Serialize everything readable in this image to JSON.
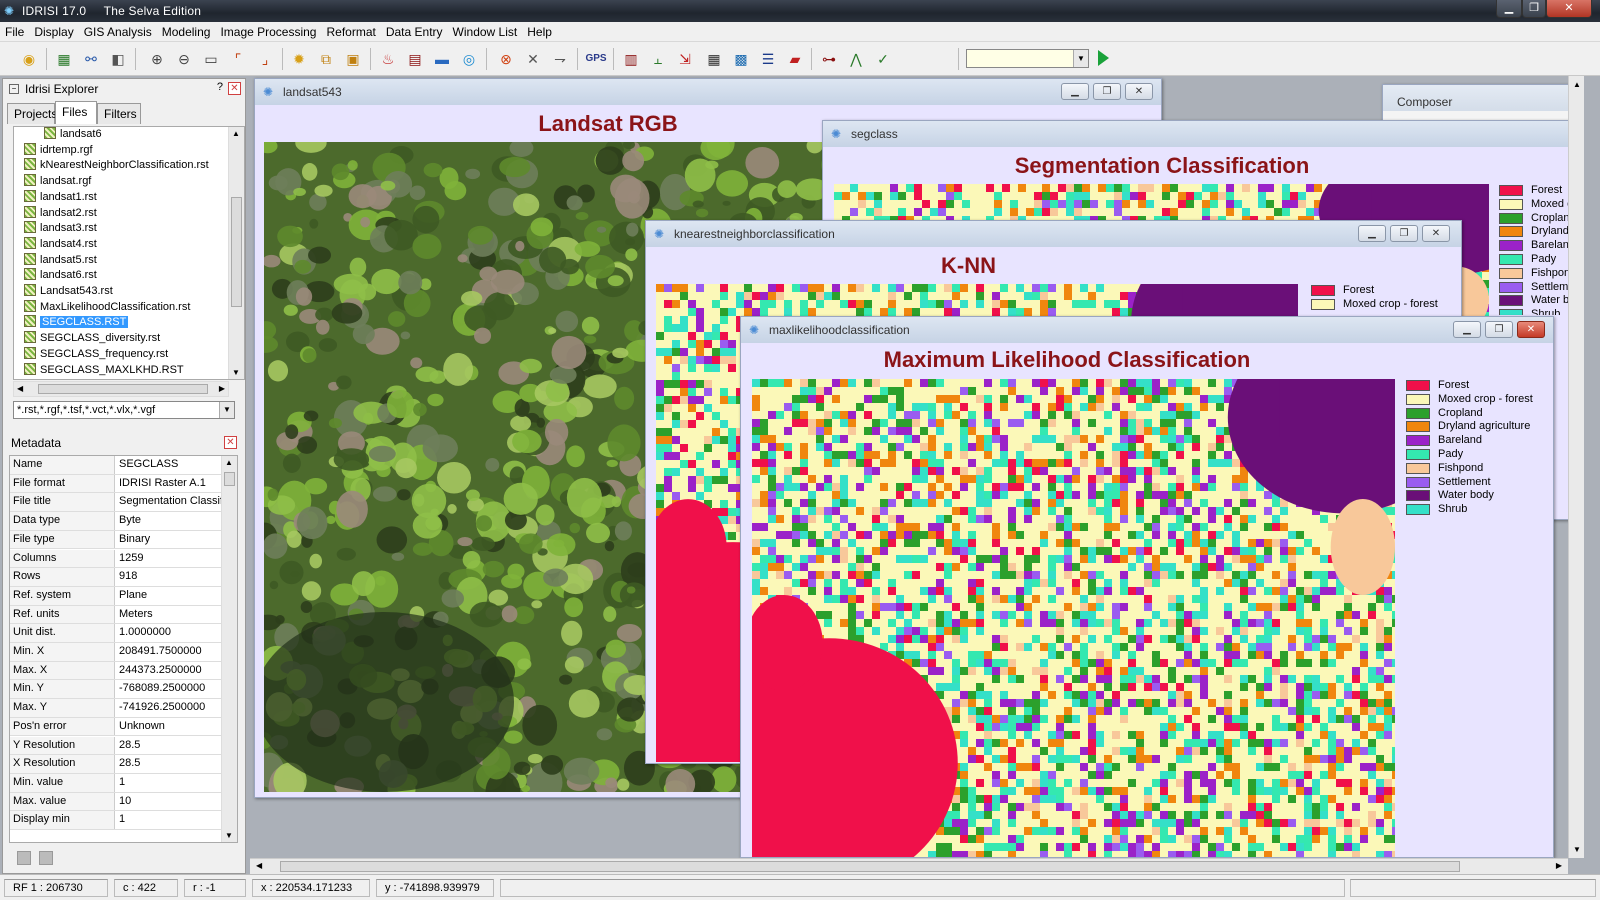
{
  "app": {
    "title": "IDRISI 17.0     The Selva Edition"
  },
  "menu": [
    "File",
    "Display",
    "GIS Analysis",
    "Modeling",
    "Image Processing",
    "Reformat",
    "Data Entry",
    "Window List",
    "Help"
  ],
  "toolbar": {
    "icons": [
      "open-icon",
      "display-icon",
      "composer-icon",
      "layer-icon",
      "zoom-in-icon",
      "zoom-out-icon",
      "zoom-window-icon",
      "pan-icon",
      "measure-icon",
      "query-icon",
      "digitize-icon",
      "palette-icon",
      "tool-icon",
      "database-icon",
      "scale-icon",
      "globe-icon",
      "target-icon",
      "tools-icon",
      "select-icon",
      "gps-icon",
      "histogram-icon",
      "profile-icon",
      "export-icon",
      "table-icon",
      "grid-icon",
      "list-icon",
      "eraser-icon",
      "macro-icon",
      "model-icon",
      "graph-icon"
    ],
    "combo_value": ""
  },
  "explorer": {
    "title": "Idrisi Explorer",
    "help": "?",
    "tabs": [
      "Projects",
      "Files",
      "Filters"
    ],
    "active_tab": 1,
    "files": [
      "landsat6",
      "idrtemp.rgf",
      "kNearestNeighborClassification.rst",
      "landsat.rgf",
      "landsat1.rst",
      "landsat2.rst",
      "landsat3.rst",
      "landsat4.rst",
      "landsat5.rst",
      "landsat6.rst",
      "Landsat543.rst",
      "MaxLikelihoodClassification.rst",
      "SEGCLASS.RST",
      "SEGCLASS_diversity.rst",
      "SEGCLASS_frequency.rst",
      "SEGCLASS_MAXLKHD.RST"
    ],
    "selected_file": 12,
    "filter": "*.rst,*.rgf,*.tsf,*.vct,*.vlx,*.vgf"
  },
  "metadata": {
    "title": "Metadata",
    "rows": [
      {
        "k": "Name",
        "v": "SEGCLASS"
      },
      {
        "k": "File format",
        "v": "IDRISI Raster A.1"
      },
      {
        "k": "File title",
        "v": "Segmentation Classific"
      },
      {
        "k": "Data type",
        "v": "Byte"
      },
      {
        "k": "File type",
        "v": "Binary"
      },
      {
        "k": "Columns",
        "v": "1259"
      },
      {
        "k": "Rows",
        "v": "918"
      },
      {
        "k": "Ref. system",
        "v": "Plane"
      },
      {
        "k": "Ref. units",
        "v": "Meters"
      },
      {
        "k": "Unit dist.",
        "v": "1.0000000"
      },
      {
        "k": "Min. X",
        "v": "208491.7500000"
      },
      {
        "k": "Max. X",
        "v": "244373.2500000"
      },
      {
        "k": "Min. Y",
        "v": "-768089.2500000"
      },
      {
        "k": "Max. Y",
        "v": "-741926.2500000"
      },
      {
        "k": "Pos'n error",
        "v": "Unknown"
      },
      {
        "k": "Y Resolution",
        "v": "28.5"
      },
      {
        "k": "X Resolution",
        "v": "28.5"
      },
      {
        "k": "Min. value",
        "v": "1"
      },
      {
        "k": "Max. value",
        "v": "10"
      },
      {
        "k": "Display min",
        "v": "1"
      }
    ]
  },
  "windows": {
    "landsat": {
      "title": "landsat543",
      "map_title": "Landsat RGB"
    },
    "composer": {
      "title": "Composer"
    },
    "segclass": {
      "title": "segclass",
      "map_title": "Segmentation Classification"
    },
    "knn": {
      "title": "knearestneighborclassification",
      "map_title": "K-NN"
    },
    "maxlik": {
      "title": "maxlikelihoodclassification",
      "map_title": "Maximum Likelihood Classification"
    }
  },
  "legend": [
    {
      "label": "Forest",
      "color": "#f0104a"
    },
    {
      "label": "Moxed crop - forest",
      "color": "#fbf8b8"
    },
    {
      "label": "Cropland",
      "color": "#2ca02c"
    },
    {
      "label": "Dryland agriculture",
      "color": "#f0860e"
    },
    {
      "label": "Bareland",
      "color": "#9b22c8"
    },
    {
      "label": "Pady",
      "color": "#34e8b0"
    },
    {
      "label": "Fishpond",
      "color": "#f8c89a"
    },
    {
      "label": "Settlement",
      "color": "#9a5cf0"
    },
    {
      "label": "Water body",
      "color": "#6a0f78"
    },
    {
      "label": "Shrub",
      "color": "#34e0c8"
    }
  ],
  "status": {
    "rf": "RF  1 : 206730",
    "c": "c : 422",
    "r": "r : -1",
    "x": "x : 220534.171233",
    "y": "y : -741898.939979"
  }
}
